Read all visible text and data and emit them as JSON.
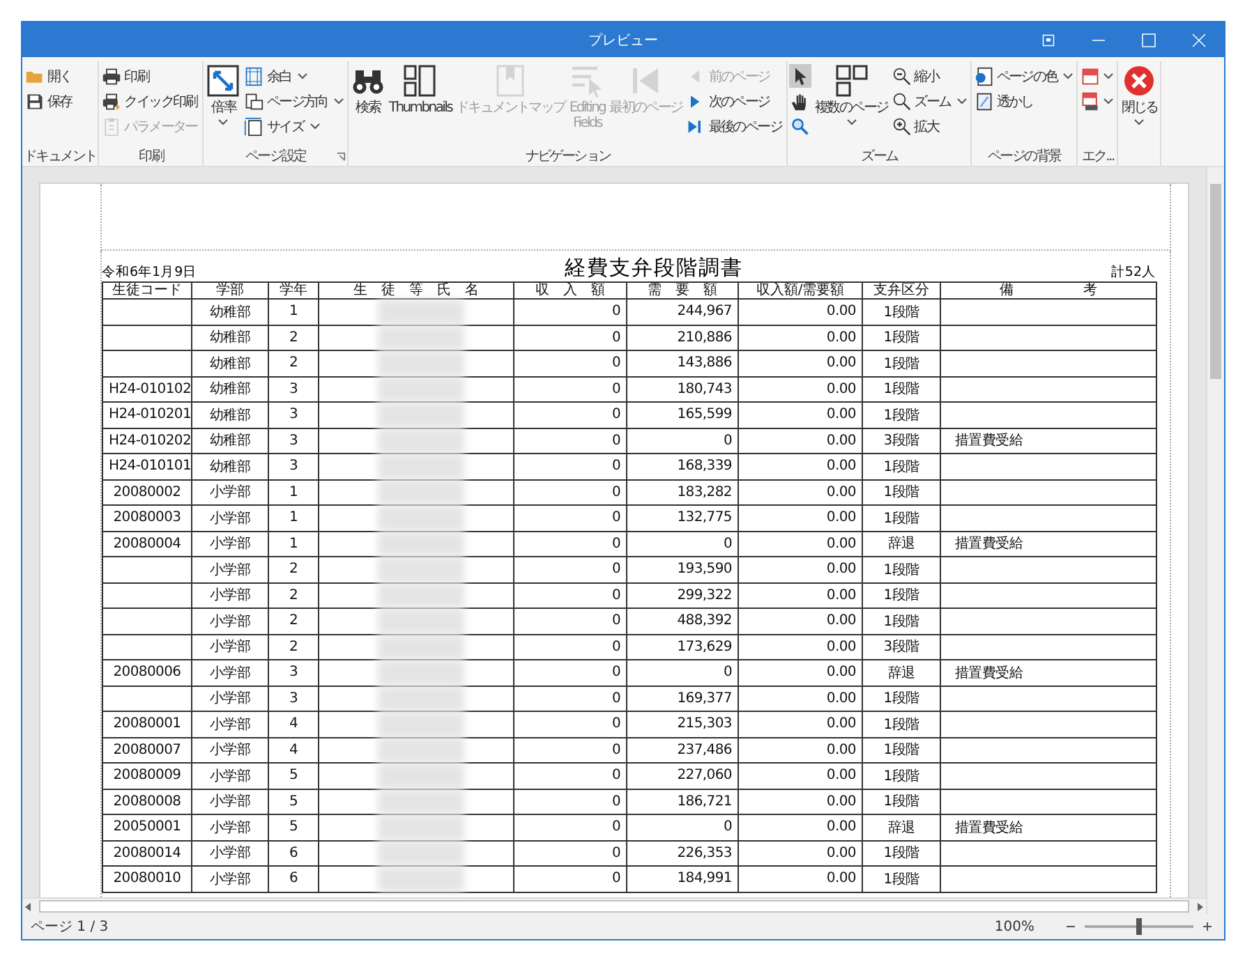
{
  "window": {
    "title": "プレビュー"
  },
  "ribbon": {
    "groups": [
      {
        "label": "ドキュメント",
        "columns": [
          {
            "kind": "stack",
            "items": [
              {
                "label": "開く",
                "disabled": false
              },
              {
                "label": "保存",
                "disabled": false
              }
            ]
          }
        ]
      },
      {
        "label": "印刷",
        "columns": [
          {
            "kind": "stack",
            "items": [
              {
                "label": "印刷",
                "disabled": false
              },
              {
                "label": "クイック印刷",
                "disabled": false
              },
              {
                "label": "パラメーター",
                "disabled": true
              }
            ]
          }
        ]
      },
      {
        "label": "ページ設定",
        "launcher": true,
        "columns": [
          {
            "kind": "large",
            "items": [
              {
                "label": "倍率",
                "disabled": false,
                "dropdown": true
              }
            ]
          },
          {
            "kind": "stack",
            "items": [
              {
                "label": "余白",
                "disabled": false,
                "dropdown": true
              },
              {
                "label": "ページ方向",
                "disabled": false,
                "dropdown": true
              },
              {
                "label": "サイズ",
                "disabled": false,
                "dropdown": true
              }
            ]
          }
        ]
      },
      {
        "label": "ナビゲーション",
        "columns": [
          {
            "kind": "large",
            "items": [
              {
                "label": "検索",
                "disabled": false
              }
            ]
          },
          {
            "kind": "large",
            "items": [
              {
                "label": "Thumbnails",
                "disabled": false
              }
            ]
          },
          {
            "kind": "large",
            "items": [
              {
                "label": "ドキュメントマップ",
                "disabled": true
              }
            ]
          },
          {
            "kind": "large",
            "items": [
              {
                "label": "Editing Fields",
                "disabled": true
              }
            ]
          },
          {
            "kind": "large",
            "items": [
              {
                "label": "最初のページ",
                "disabled": true
              }
            ]
          },
          {
            "kind": "stack",
            "items": [
              {
                "label": "前のページ",
                "disabled": true
              },
              {
                "label": "次のページ",
                "disabled": false
              },
              {
                "label": "最後のページ",
                "disabled": false
              }
            ]
          }
        ]
      },
      {
        "label": "ズーム",
        "columns": [
          {
            "kind": "stack",
            "items": [
              {
                "disabled": false,
                "selected": true
              },
              {
                "disabled": false,
                "selected": false
              },
              {
                "disabled": false,
                "selected": false
              }
            ]
          },
          {
            "kind": "large",
            "items": [
              {
                "label": "複数のページ",
                "disabled": false,
                "dropdown": true
              }
            ]
          },
          {
            "kind": "stack",
            "items": [
              {
                "label": "縮小",
                "disabled": false
              },
              {
                "label": "ズーム",
                "disabled": false,
                "dropdown": true
              },
              {
                "label": "拡大",
                "disabled": false
              }
            ]
          }
        ]
      },
      {
        "label": "ページの背景",
        "columns": [
          {
            "kind": "stack",
            "items": [
              {
                "label": "ページの色",
                "disabled": false,
                "dropdown": true
              },
              {
                "label": "透かし",
                "disabled": false
              }
            ]
          }
        ]
      },
      {
        "label": "エク...",
        "columns": [
          {
            "kind": "stack",
            "items": [
              {
                "disabled": false,
                "dropdown": true
              },
              {
                "disabled": false,
                "dropdown": true
              }
            ]
          }
        ]
      },
      {
        "columns": [
          {
            "kind": "large",
            "items": [
              {
                "label": "閉じる",
                "disabled": false,
                "dropdown": true
              }
            ]
          }
        ]
      }
    ]
  },
  "report": {
    "date": "令和6年1月9日",
    "title": "経費支弁段階調書",
    "total": "計52人",
    "columns": [
      "生徒コード",
      "学部",
      "学年",
      "生　徒　等　氏　名",
      "収　入　額",
      "需　要　額",
      "収入額/需要額",
      "支弁区分",
      "備　　　　　考"
    ],
    "rows": [
      {
        "department": "幼稚部",
        "grade": "1",
        "income": "0",
        "requirement": "244,967",
        "ratio": "0.00",
        "classification": "1段階"
      },
      {
        "department": "幼稚部",
        "grade": "2",
        "income": "0",
        "requirement": "210,886",
        "ratio": "0.00",
        "classification": "1段階"
      },
      {
        "department": "幼稚部",
        "grade": "2",
        "income": "0",
        "requirement": "143,886",
        "ratio": "0.00",
        "classification": "1段階"
      },
      {
        "student_code": "H24-010102",
        "department": "幼稚部",
        "grade": "3",
        "income": "0",
        "requirement": "180,743",
        "ratio": "0.00",
        "classification": "1段階"
      },
      {
        "student_code": "H24-010201",
        "department": "幼稚部",
        "grade": "3",
        "income": "0",
        "requirement": "165,599",
        "ratio": "0.00",
        "classification": "1段階"
      },
      {
        "student_code": "H24-010202",
        "department": "幼稚部",
        "grade": "3",
        "income": "0",
        "requirement": "0",
        "ratio": "0.00",
        "classification": "3段階",
        "remarks": "措置費受給"
      },
      {
        "student_code": "H24-010101",
        "department": "幼稚部",
        "grade": "3",
        "income": "0",
        "requirement": "168,339",
        "ratio": "0.00",
        "classification": "1段階"
      },
      {
        "student_code": "20080002",
        "department": "小学部",
        "grade": "1",
        "income": "0",
        "requirement": "183,282",
        "ratio": "0.00",
        "classification": "1段階"
      },
      {
        "student_code": "20080003",
        "department": "小学部",
        "grade": "1",
        "income": "0",
        "requirement": "132,775",
        "ratio": "0.00",
        "classification": "1段階"
      },
      {
        "student_code": "20080004",
        "department": "小学部",
        "grade": "1",
        "income": "0",
        "requirement": "0",
        "ratio": "0.00",
        "classification": "辞退",
        "remarks": "措置費受給"
      },
      {
        "department": "小学部",
        "grade": "2",
        "income": "0",
        "requirement": "193,590",
        "ratio": "0.00",
        "classification": "1段階"
      },
      {
        "department": "小学部",
        "grade": "2",
        "income": "0",
        "requirement": "299,322",
        "ratio": "0.00",
        "classification": "1段階"
      },
      {
        "department": "小学部",
        "grade": "2",
        "income": "0",
        "requirement": "488,392",
        "ratio": "0.00",
        "classification": "1段階"
      },
      {
        "department": "小学部",
        "grade": "2",
        "income": "0",
        "requirement": "173,629",
        "ratio": "0.00",
        "classification": "3段階"
      },
      {
        "student_code": "20080006",
        "department": "小学部",
        "grade": "3",
        "income": "0",
        "requirement": "0",
        "ratio": "0.00",
        "classification": "辞退",
        "remarks": "措置費受給"
      },
      {
        "department": "小学部",
        "grade": "3",
        "income": "0",
        "requirement": "169,377",
        "ratio": "0.00",
        "classification": "1段階"
      },
      {
        "student_code": "20080001",
        "department": "小学部",
        "grade": "4",
        "income": "0",
        "requirement": "215,303",
        "ratio": "0.00",
        "classification": "1段階"
      },
      {
        "student_code": "20080007",
        "department": "小学部",
        "grade": "4",
        "income": "0",
        "requirement": "237,486",
        "ratio": "0.00",
        "classification": "1段階"
      },
      {
        "student_code": "20080009",
        "department": "小学部",
        "grade": "5",
        "income": "0",
        "requirement": "227,060",
        "ratio": "0.00",
        "classification": "1段階"
      },
      {
        "student_code": "20080008",
        "department": "小学部",
        "grade": "5",
        "income": "0",
        "requirement": "186,721",
        "ratio": "0.00",
        "classification": "1段階"
      },
      {
        "student_code": "20050001",
        "department": "小学部",
        "grade": "5",
        "income": "0",
        "requirement": "0",
        "ratio": "0.00",
        "classification": "辞退",
        "remarks": "措置費受給"
      },
      {
        "student_code": "20080014",
        "department": "小学部",
        "grade": "6",
        "income": "0",
        "requirement": "226,353",
        "ratio": "0.00",
        "classification": "1段階"
      },
      {
        "student_code": "20080010",
        "department": "小学部",
        "grade": "6",
        "income": "0",
        "requirement": "184,991",
        "ratio": "0.00",
        "classification": "1段階"
      }
    ]
  },
  "status_bar": {
    "page": "ページ 1 / 3",
    "zoom": "100%",
    "zoom_slider": {
      "level": 0.5
    }
  }
}
